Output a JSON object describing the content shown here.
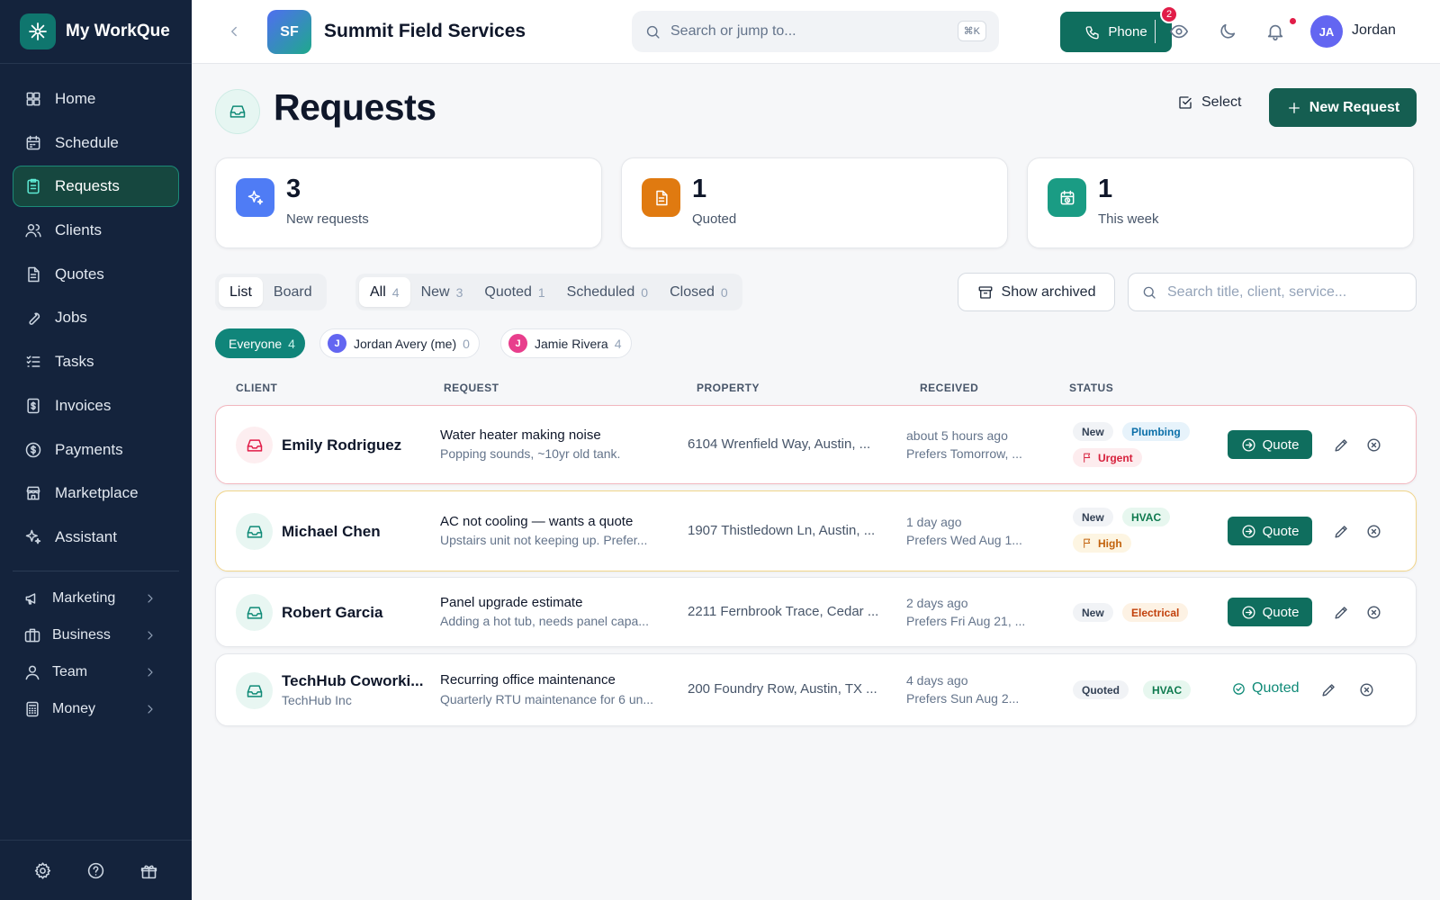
{
  "app": {
    "name": "My WorkQue"
  },
  "sidebar": {
    "items": [
      {
        "label": "Home",
        "icon": "home-grid-icon",
        "active": false
      },
      {
        "label": "Schedule",
        "icon": "calendar-icon",
        "active": false
      },
      {
        "label": "Requests",
        "icon": "clipboard-icon",
        "active": true
      },
      {
        "label": "Clients",
        "icon": "users-icon",
        "active": false
      },
      {
        "label": "Quotes",
        "icon": "document-icon",
        "active": false
      },
      {
        "label": "Jobs",
        "icon": "wrench-icon",
        "active": false
      },
      {
        "label": "Tasks",
        "icon": "checklist-icon",
        "active": false
      },
      {
        "label": "Invoices",
        "icon": "invoice-icon",
        "active": false
      },
      {
        "label": "Payments",
        "icon": "dollar-circle-icon",
        "active": false
      },
      {
        "label": "Marketplace",
        "icon": "store-icon",
        "active": false
      },
      {
        "label": "Assistant",
        "icon": "sparkles-icon",
        "active": false
      }
    ],
    "groups": [
      {
        "label": "Marketing",
        "icon": "megaphone-icon"
      },
      {
        "label": "Business",
        "icon": "briefcase-icon"
      },
      {
        "label": "Team",
        "icon": "user-icon"
      },
      {
        "label": "Money",
        "icon": "calculator-icon"
      }
    ],
    "footer_icons": [
      "gear-icon",
      "help-icon",
      "gift-icon"
    ]
  },
  "topbar": {
    "org_initials": "SF",
    "org_name": "Summit Field Services",
    "search_placeholder": "Search or jump to...",
    "search_shortcut": "⌘K",
    "phone_label": "Phone",
    "phone_count": "2",
    "user_initials": "JA",
    "user_name": "Jordan"
  },
  "page": {
    "title": "Requests",
    "select_label": "Select",
    "new_label": "New Request"
  },
  "stats": [
    {
      "value": "3",
      "label": "New requests",
      "color": "#4f7cf5",
      "icon": "sparkles-icon"
    },
    {
      "value": "1",
      "label": "Quoted",
      "color": "#e07a10",
      "icon": "document-icon"
    },
    {
      "value": "1",
      "label": "This week",
      "color": "#1a9c84",
      "icon": "calendar-clock-icon"
    }
  ],
  "view_toggle": [
    {
      "label": "List",
      "active": true
    },
    {
      "label": "Board",
      "active": false
    }
  ],
  "status_tabs": [
    {
      "label": "All",
      "count": "4",
      "active": true
    },
    {
      "label": "New",
      "count": "3",
      "active": false
    },
    {
      "label": "Quoted",
      "count": "1",
      "active": false
    },
    {
      "label": "Scheduled",
      "count": "0",
      "active": false
    },
    {
      "label": "Closed",
      "count": "0",
      "active": false
    }
  ],
  "archived_label": "Show archived",
  "list_search_placeholder": "Search title, client, service...",
  "assignees": [
    {
      "label": "Everyone",
      "count": "4",
      "initial": "",
      "color": "",
      "active": true
    },
    {
      "label": "Jordan Avery (me)",
      "count": "0",
      "initial": "J",
      "color": "#6366f1",
      "active": false
    },
    {
      "label": "Jamie Rivera",
      "count": "4",
      "initial": "J",
      "color": "#e83e8c",
      "active": false
    }
  ],
  "columns": [
    "CLIENT",
    "REQUEST",
    "PROPERTY",
    "RECEIVED",
    "STATUS"
  ],
  "rows": [
    {
      "client": "Emily Rodriguez",
      "company": "",
      "title": "Water heater making noise",
      "description": "Popping sounds, ~10yr old tank.",
      "property": "6104 Wrenfield Way, Austin, ...",
      "received": "about 5 hours ago",
      "prefers": "Prefers Tomorrow, ...",
      "status": "New",
      "service": "Plumbing",
      "priority": "Urgent",
      "action": "Quote"
    },
    {
      "client": "Michael Chen",
      "company": "",
      "title": "AC not cooling — wants a quote",
      "description": "Upstairs unit not keeping up. Prefer...",
      "property": "1907 Thistledown Ln, Austin, ...",
      "received": "1 day ago",
      "prefers": "Prefers Wed Aug 1...",
      "status": "New",
      "service": "HVAC",
      "priority": "High",
      "action": "Quote"
    },
    {
      "client": "Robert Garcia",
      "company": "",
      "title": "Panel upgrade estimate",
      "description": "Adding a hot tub, needs panel capa...",
      "property": "2211 Fernbrook Trace, Cedar ...",
      "received": "2 days ago",
      "prefers": "Prefers Fri Aug 21, ...",
      "status": "New",
      "service": "Electrical",
      "priority": "",
      "action": "Quote"
    },
    {
      "client": "TechHub Coworki...",
      "company": "TechHub Inc",
      "title": "Recurring office maintenance",
      "description": "Quarterly RTU maintenance for 6 un...",
      "property": "200 Foundry Row, Austin, TX ...",
      "received": "4 days ago",
      "prefers": "Prefers Sun Aug 2...",
      "status": "Quoted",
      "service": "HVAC",
      "priority": "",
      "action": "Quoted"
    }
  ]
}
